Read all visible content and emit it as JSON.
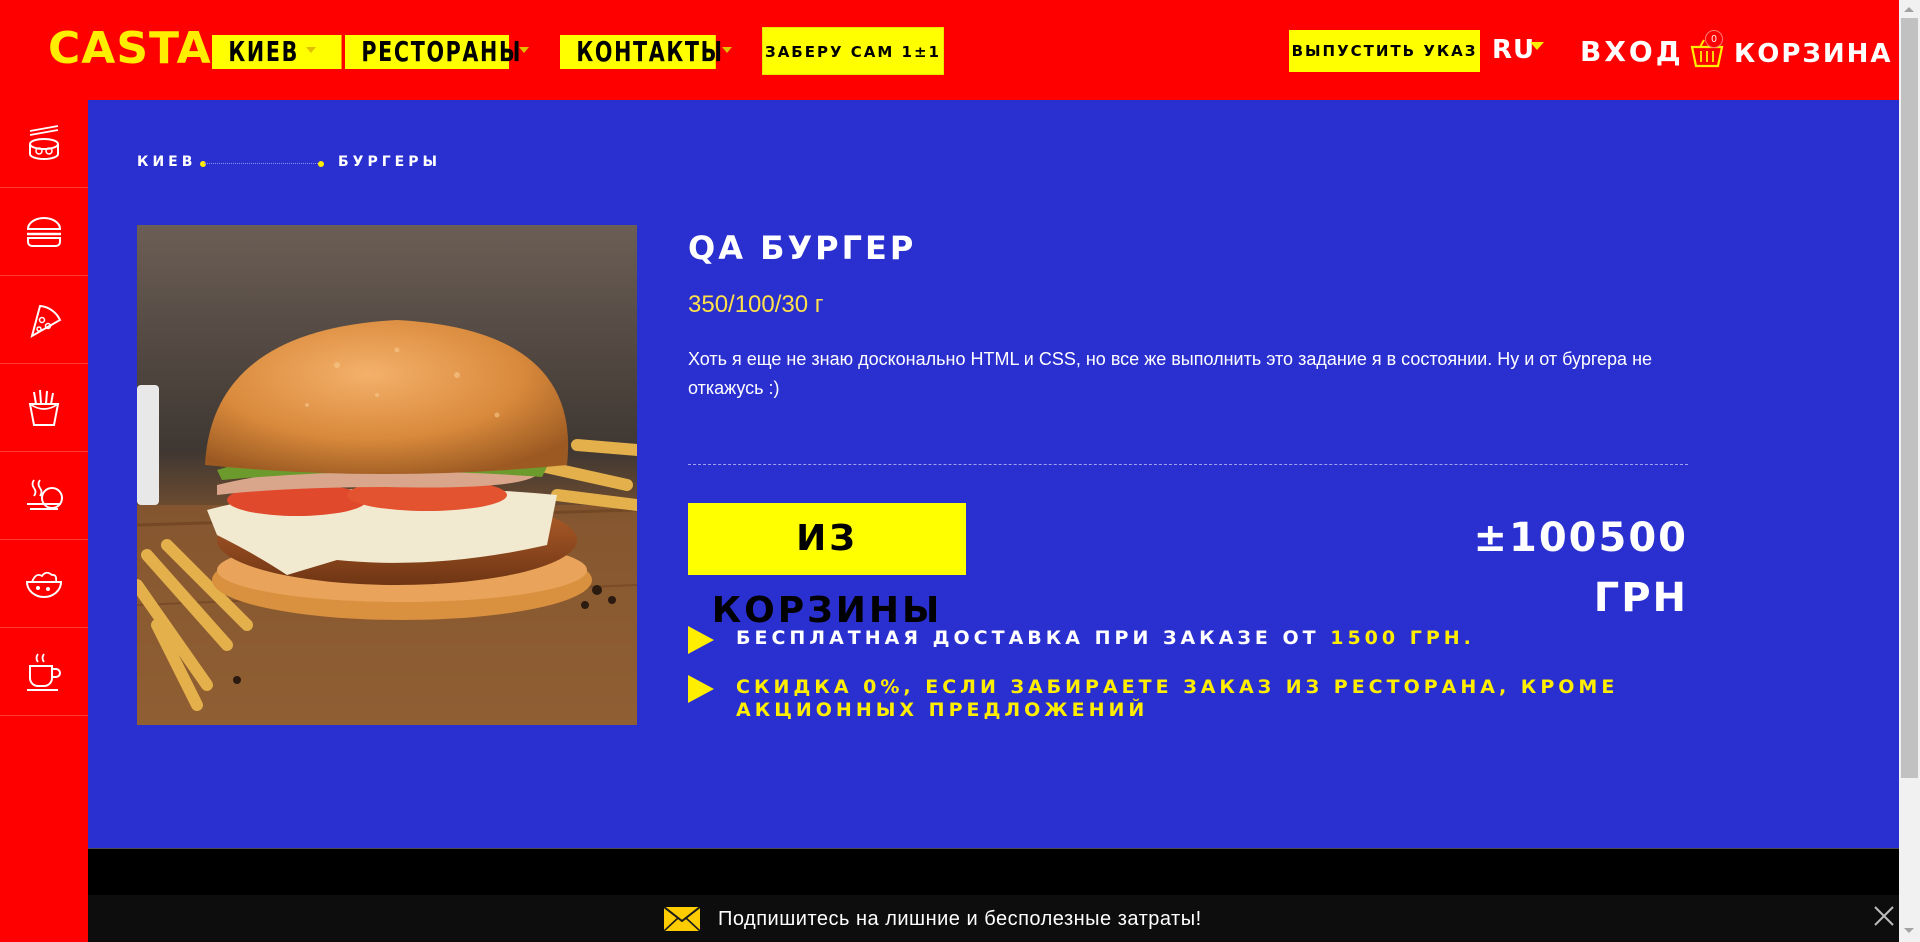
{
  "header": {
    "logo": "CASTA",
    "nav": [
      {
        "label": "КИЕВ"
      },
      {
        "label": "РЕСТОРАНЫ"
      },
      {
        "label": "КОНТАКТЫ"
      }
    ],
    "pickup_label": "ЗАБЕРУ САМ 1±1",
    "release_label": "ВЫПУСТИТЬ УКАЗ",
    "language": "RU",
    "login_label": "ВХОД",
    "cart_count": "0",
    "cart_label": "КОРЗИНА",
    "accent_color": "#ffff00",
    "brand_color": "#ff0000"
  },
  "sidebar": {
    "items": [
      {
        "icon": "sushi-icon"
      },
      {
        "icon": "burger-icon"
      },
      {
        "icon": "pizza-icon"
      },
      {
        "icon": "fries-icon"
      },
      {
        "icon": "hot-dish-icon"
      },
      {
        "icon": "salad-bowl-icon"
      },
      {
        "icon": "coffee-cup-icon"
      }
    ]
  },
  "breadcrumb": {
    "items": [
      "КИЕВ",
      "БУРГЕРЫ"
    ]
  },
  "product": {
    "title": "QA БУРГЕР",
    "weight": "350/100/30 г",
    "description": "Хоть я еще не знаю досконально HTML и CSS, но все же выполнить это задание я в состоянии. Ну и от бургера не откажусь :)",
    "cart_button": "ИЗ КОРЗИНЫ",
    "price": "±100500 ГРН",
    "background_color": "#2a2fd0"
  },
  "info": {
    "delivery_prefix": "БЕСПЛАТНАЯ ДОСТАВКА ПРИ ЗАКАЗЕ ОТ ",
    "delivery_amount": "1500 ГРН.",
    "discount": "СКИДКА 0%, ЕСЛИ ЗАБИРАЕТЕ ЗАКАЗ ИЗ РЕСТОРАНА, КРОМЕ АКЦИОННЫХ ПРЕДЛОЖЕНИЙ"
  },
  "subscribe": {
    "text": "Подпишитесь на лишние и бесполезные затраты!"
  }
}
